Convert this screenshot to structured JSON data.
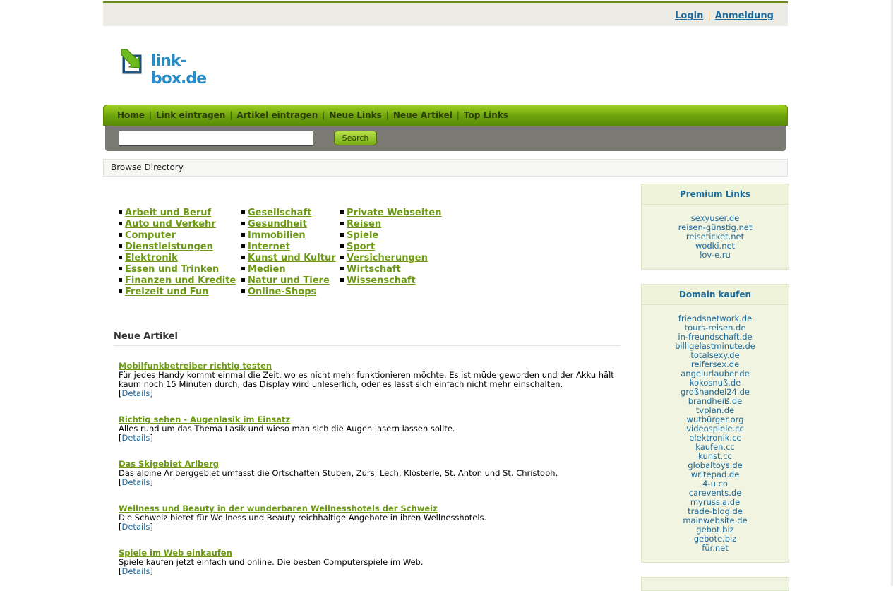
{
  "header": {
    "login_label": "Login",
    "register_label": "Anmeldung",
    "separator": "|"
  },
  "logo": {
    "text": "link-box.de"
  },
  "nav": {
    "items": [
      "Home",
      "Link eintragen",
      "Artikel eintragen",
      "Neue Links",
      "Neue Artikel",
      "Top Links"
    ],
    "separator": "|"
  },
  "search": {
    "input_value": "",
    "button_label": "Search"
  },
  "breadcrumb": {
    "label": "Browse Directory"
  },
  "categories": {
    "col1": [
      "Arbeit und Beruf",
      "Auto und Verkehr",
      "Computer",
      "Dienstleistungen",
      "Elektronik",
      "Essen und Trinken",
      "Finanzen und Kredite",
      "Freizeit und Fun"
    ],
    "col2": [
      "Gesellschaft",
      "Gesundheit",
      "Immobilien",
      "Internet",
      "Kunst und Kultur",
      "Medien",
      "Natur und Tiere",
      "Online-Shops"
    ],
    "col3": [
      "Private Webseiten",
      "Reisen",
      "Spiele",
      "Sport",
      "Versicherungen",
      "Wirtschaft",
      "Wissenschaft"
    ]
  },
  "articles": {
    "heading": "Neue Artikel",
    "details_label": "Details",
    "bracket_open": "[",
    "bracket_close": "]",
    "items": [
      {
        "title": "Mobilfunkbetreiber richtig testen",
        "text": "Für jedes Handy kommt einmal die Zeit, wo es nicht mehr funktionieren möchte. Es ist müde geworden und der Akku hält kaum noch 15 Minuten durch, das Display wird unleserlich, oder es lässt sich einfach nicht mehr einschalten."
      },
      {
        "title": "Richtig sehen - Augenlasik im Einsatz",
        "text": "Alles rund um das Thema Lasik und wieso man sich die Augen lasern lassen sollte."
      },
      {
        "title": "Das Skigebiet Arlberg",
        "text": "Das alpine Arlberggebiet umfasst die Ortschaften Stuben, Zürs, Lech, Klösterle, St. Anton und St. Christoph."
      },
      {
        "title": "Wellness und Beauty in der wunderbaren Wellnesshotels der Schweiz",
        "text": "Die Schweiz bietet für Wellness und Beauty reichhaltige Angebote in ihren Wellnesshotels."
      },
      {
        "title": "Spiele im Web einkaufen",
        "text": "Spiele kaufen jetzt einfach und online. Die besten Computerspiele im Web."
      }
    ]
  },
  "premium_links": {
    "heading": "Premium Links",
    "items": [
      "sexyuser.de",
      "reisen-günstig.net",
      "reiseticket.net",
      "wodki.net",
      "lov-e.ru"
    ]
  },
  "domain_kaufen": {
    "heading": "Domain kaufen",
    "items": [
      "friendsnetwork.de",
      "tours-reisen.de",
      "in-freundschaft.de",
      "billigelastminute.de",
      "totalsexy.de",
      "reifersex.de",
      "angelurlauber.de",
      "kokosnuß.de",
      "großhandel24.de",
      "brandheiß.de",
      "tvplan.de",
      "wutbürger.org",
      "videospiele.cc",
      "elektronik.cc",
      "kaufen.cc",
      "kunst.cc",
      "globaltoys.de",
      "writepad.de",
      "4-u.co",
      "carevents.de",
      "myrussia.de",
      "trade-blog.de",
      "mainwebsite.de",
      "gebot.biz",
      "gebote.biz",
      "für.net"
    ]
  },
  "colors": {
    "nav_green": "#6ca20c",
    "link_green": "#6d9a14",
    "link_blue": "#1d6a9c",
    "search_bar_gray": "#7a7a72",
    "sidebox_bg": "#f0f4e0"
  }
}
